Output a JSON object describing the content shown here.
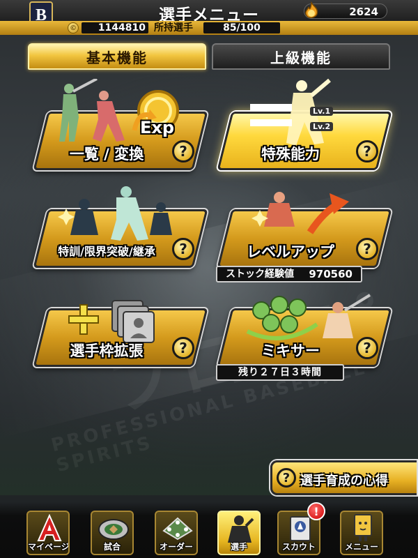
{
  "header": {
    "team_logo_letter": "B",
    "title": "選手メニュー",
    "gold_count": "2624",
    "money": "1144810",
    "owned_label": "所持選手",
    "owned_count": "85/100"
  },
  "tabs": [
    {
      "label": "基本機能",
      "active": true
    },
    {
      "label": "上級機能",
      "active": false
    }
  ],
  "menu": {
    "list_convert": {
      "label": "一覧 / 変換",
      "exp_badge": "Exp"
    },
    "special_ability": {
      "label": "特殊能力",
      "lv1": "Lv.1",
      "lv2": "Lv.2"
    },
    "training": {
      "label": "特訓/限界突破/継承"
    },
    "level_up": {
      "label": "レベルアップ",
      "stock_label": "ストック経験値",
      "stock_value": "970560"
    },
    "expand_slots": {
      "label": "選手枠拡張"
    },
    "mixer": {
      "label": "ミキサー",
      "remaining": "残り２７日３時間"
    }
  },
  "tips": {
    "label": "選手育成の心得"
  },
  "nav": [
    {
      "label": "マイページ",
      "icon": "mypage-icon"
    },
    {
      "label": "試合",
      "icon": "stadium-icon"
    },
    {
      "label": "オーダー",
      "icon": "order-icon"
    },
    {
      "label": "選手",
      "icon": "player-icon",
      "active": true
    },
    {
      "label": "スカウト",
      "icon": "scout-icon"
    },
    {
      "label": "メニュー",
      "icon": "menu-icon"
    }
  ],
  "notification_badge": "!",
  "colors": {
    "gold": "#e6b520",
    "dark": "#111111",
    "accent_red": "#cc0000"
  }
}
